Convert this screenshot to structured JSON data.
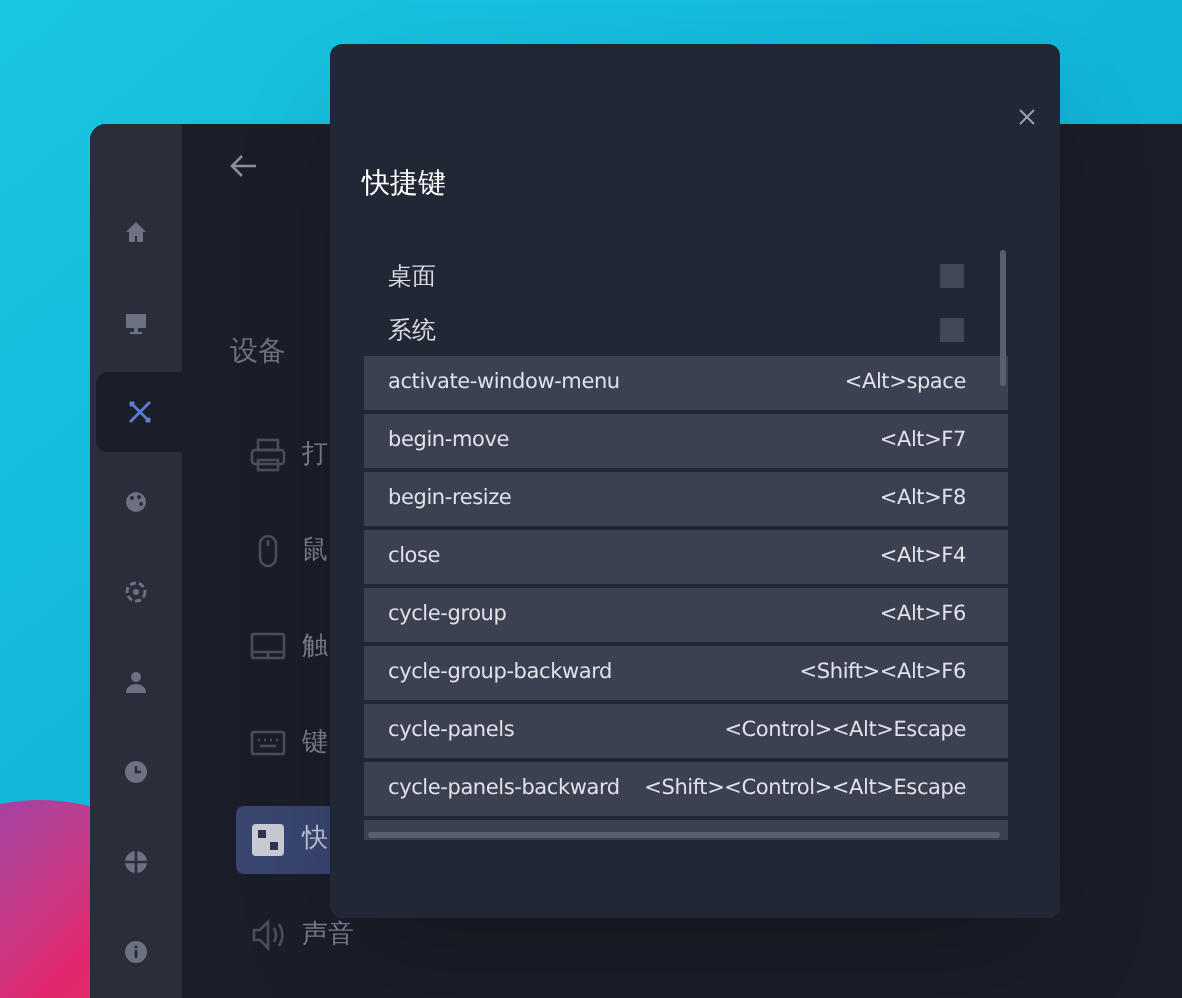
{
  "nav_icons": [
    {
      "kind": "home",
      "selected": false
    },
    {
      "kind": "monitor",
      "selected": false
    },
    {
      "kind": "tools",
      "selected": true
    },
    {
      "kind": "palette",
      "selected": false
    },
    {
      "kind": "network",
      "selected": false
    },
    {
      "kind": "user",
      "selected": false
    },
    {
      "kind": "clock",
      "selected": false
    },
    {
      "kind": "globe",
      "selected": false
    },
    {
      "kind": "info",
      "selected": false
    }
  ],
  "section_title": "设备",
  "devices": [
    {
      "kind": "printer",
      "label": "打",
      "selected": false
    },
    {
      "kind": "mouse",
      "label": "鼠",
      "selected": false
    },
    {
      "kind": "touchpad",
      "label": "触",
      "selected": false
    },
    {
      "kind": "keyboard",
      "label": "键",
      "selected": false
    },
    {
      "kind": "shortcut",
      "label": "快",
      "selected": true
    },
    {
      "kind": "sound",
      "label": "声音",
      "selected": false
    }
  ],
  "dialog": {
    "title": "快捷键",
    "groups": [
      {
        "label": "桌面",
        "checked": false
      },
      {
        "label": "系统",
        "checked": false
      }
    ],
    "shortcuts": [
      {
        "name": "activate-window-menu",
        "keys": "<Alt>space"
      },
      {
        "name": "begin-move",
        "keys": "<Alt>F7"
      },
      {
        "name": "begin-resize",
        "keys": "<Alt>F8"
      },
      {
        "name": "close",
        "keys": "<Alt>F4"
      },
      {
        "name": "cycle-group",
        "keys": "<Alt>F6"
      },
      {
        "name": "cycle-group-backward",
        "keys": "<Shift><Alt>F6"
      },
      {
        "name": "cycle-panels",
        "keys": "<Control><Alt>Escape"
      },
      {
        "name": "cycle-panels-backward",
        "keys": "<Shift><Control><Alt>Escape"
      }
    ]
  }
}
